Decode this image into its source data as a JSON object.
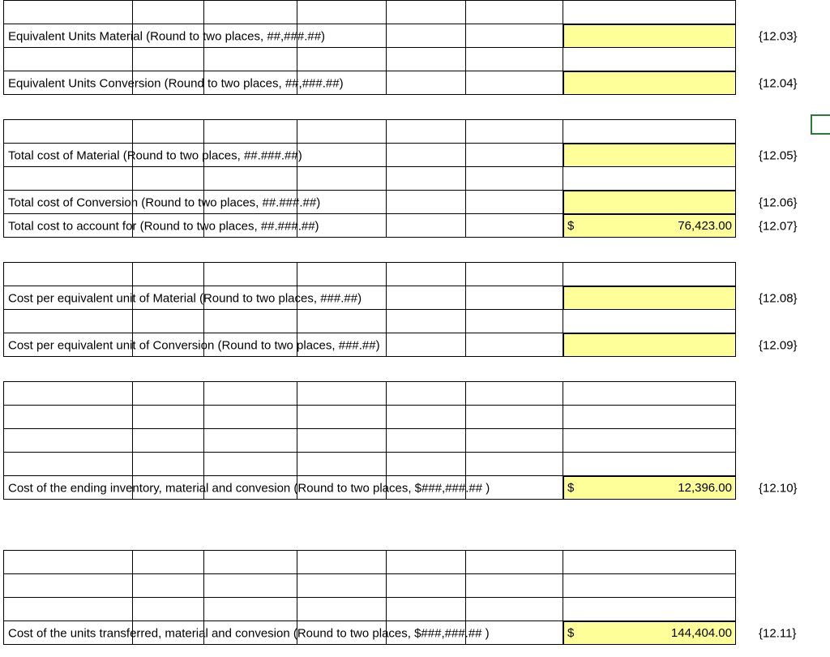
{
  "rows": {
    "eq_mat": {
      "label": "Equivalent Units Material (Round to two places, ##,###.##)",
      "ref": "{12.03}"
    },
    "eq_conv": {
      "label": "Equivalent Units Conversion (Round to two places, ##,###.##)",
      "ref": "{12.04}"
    },
    "cost_mat": {
      "label": "Total cost of Material (Round to two places, ##.###.##)",
      "ref": "{12.05}"
    },
    "cost_conv": {
      "label": "Total cost of Conversion (Round to two places, ##.###.##)",
      "ref": "{12.06}"
    },
    "cost_total": {
      "label": "Total cost to account for (Round to two places, ##.###.##)",
      "currency": "$",
      "value": "76,423.00",
      "ref": "{12.07}"
    },
    "cpeu_mat": {
      "label": "Cost per equivalent unit of Material (Round to two places, ###.##)",
      "ref": "{12.08}"
    },
    "cpeu_conv": {
      "label": "Cost per equivalent unit of Conversion (Round to two places, ###.##)",
      "ref": "{12.09}"
    },
    "end_inv": {
      "label": "Cost of the ending inventory, material and convesion (Round to two places, $###,###.## )",
      "currency": "$",
      "value": "12,396.00",
      "ref": "{12.10}"
    },
    "transferred": {
      "label": "Cost of the units transferred, material and convesion (Round to two places, $###,###.## )",
      "currency": "$",
      "value": "144,404.00",
      "ref": "{12.11}"
    }
  }
}
